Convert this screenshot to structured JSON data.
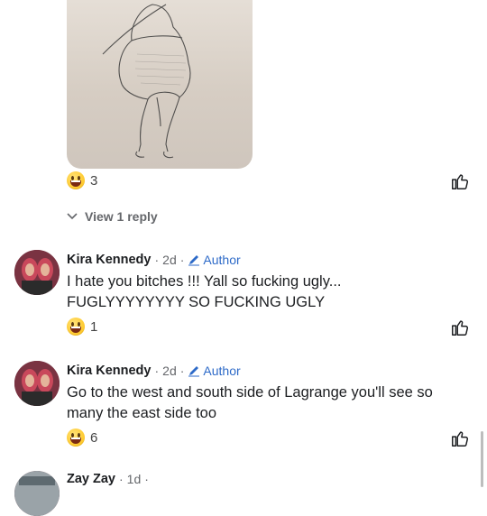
{
  "post_image": {
    "alt": ""
  },
  "post_reactions": {
    "count": "3"
  },
  "view_replies": {
    "label": "View 1 reply"
  },
  "comments": [
    {
      "author": "Kira Kennedy",
      "time": "2d",
      "badge": "Author",
      "text_line1": "I hate you bitches !!! Yall so fucking ugly...",
      "text_line2": "FUGLYYYYYYYY SO FUCKING UGLY",
      "reaction_count": "1"
    },
    {
      "author": "Kira Kennedy",
      "time": "2d",
      "badge": "Author",
      "text_line1": "Go to the west and south side of Lagrange you'll see so",
      "text_line2": "many the east side too",
      "reaction_count": "6"
    },
    {
      "author": "Zay Zay",
      "time": "1d"
    }
  ],
  "colors": {
    "author_badge": "#2d6ac8",
    "meta": "#65676b",
    "text": "#1c1e21"
  },
  "icons": {
    "like": "thumbs-up-icon",
    "reaction": "grinning-emoji-icon",
    "expand": "chevron-down-icon",
    "author": "pencil-icon"
  }
}
